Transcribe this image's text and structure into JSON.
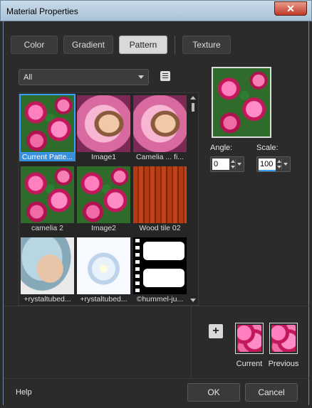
{
  "window": {
    "title": "Material Properties",
    "close_glyph": "✕"
  },
  "tabs": [
    {
      "label": "Color",
      "active": false
    },
    {
      "label": "Gradient",
      "active": false
    },
    {
      "label": "Pattern",
      "active": true
    },
    {
      "label": "Texture",
      "active": false
    }
  ],
  "filter": {
    "value": "All"
  },
  "patterns": [
    {
      "label": "Current Patte...",
      "art": "roses",
      "selected": true
    },
    {
      "label": "Image1",
      "art": "face",
      "selected": false
    },
    {
      "label": "Camelia ... fi...",
      "art": "face",
      "selected": false
    },
    {
      "label": "camelia 2",
      "art": "roses",
      "selected": false
    },
    {
      "label": "Image2",
      "art": "roses",
      "selected": false
    },
    {
      "label": "Wood tile 02",
      "art": "wood",
      "selected": false
    },
    {
      "label": "+rystaltubed...",
      "art": "portrait",
      "selected": false
    },
    {
      "label": "+rystaltubed...",
      "art": "flower",
      "selected": false
    },
    {
      "label": "©hummel-ju...",
      "art": "film",
      "selected": false
    }
  ],
  "angle": {
    "label": "Angle:",
    "value": "0"
  },
  "scale": {
    "label": "Scale:",
    "value": "100"
  },
  "add_glyph": "+",
  "current": {
    "label": "Current"
  },
  "previous": {
    "label": "Previous"
  },
  "footer": {
    "help": "Help",
    "ok": "OK",
    "cancel": "Cancel"
  },
  "colors": {
    "accent": "#3a8fdd",
    "background": "#2b2b2b",
    "title_bar": "#b9cfe2",
    "close_button": "#c0392b"
  }
}
